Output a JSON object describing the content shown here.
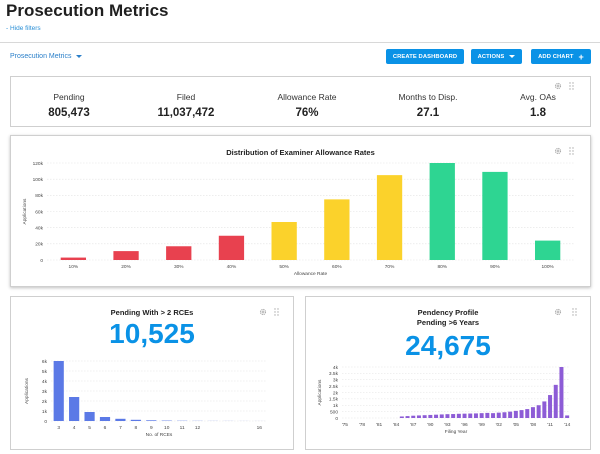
{
  "page": {
    "title": "Prosecution Metrics",
    "hide_filters": "- Hide filters",
    "dashboard_select": "Prosecution Metrics"
  },
  "toolbar": {
    "create_dashboard": "CREATE DASHBOARD",
    "actions": "ACTIONS",
    "add_chart": "ADD CHART"
  },
  "icons": {
    "settings": "gear-icon",
    "drag": "drag-handle-icon",
    "dropdown": "caret-down-icon",
    "add": "plus-icon"
  },
  "colors": {
    "accent": "#0a92e6",
    "red": "#e8414f",
    "yellow": "#fbd22b",
    "green": "#2ed592",
    "blue_bar": "#5b79e6",
    "purple_bar": "#8d5cd6"
  },
  "kpis": [
    {
      "label": "Pending",
      "value": "805,473"
    },
    {
      "label": "Filed",
      "value": "11,037,472"
    },
    {
      "label": "Allowance Rate",
      "value": "76%"
    },
    {
      "label": "Months to Disp.",
      "value": "27.1"
    },
    {
      "label": "Avg. OAs",
      "value": "1.8"
    }
  ],
  "chart_data": [
    {
      "type": "bar",
      "title": "Distribution of Examiner Allowance Rates",
      "xlabel": "Allowance Rate",
      "ylabel": "Applications",
      "categories": [
        "10%",
        "20%",
        "30%",
        "40%",
        "50%",
        "60%",
        "70%",
        "80%",
        "90%",
        "100%"
      ],
      "values": [
        3000,
        11000,
        17000,
        30000,
        47000,
        75000,
        105000,
        125000,
        109000,
        24000
      ],
      "bar_colors": [
        "red",
        "red",
        "red",
        "red",
        "yellow",
        "yellow",
        "yellow",
        "green",
        "green",
        "green"
      ],
      "ylim": [
        0,
        120000
      ],
      "yticks": [
        0,
        20000,
        40000,
        60000,
        80000,
        100000,
        120000
      ],
      "ytick_labels": [
        "0",
        "20k",
        "40k",
        "60k",
        "80k",
        "100k",
        "120k"
      ],
      "grid": true
    },
    {
      "type": "bar",
      "title": "Pending With > 2 RCEs",
      "headline": "10,525",
      "xlabel": "No. of RCEs",
      "ylabel": "Applications",
      "categories": [
        "3",
        "4",
        "5",
        "6",
        "7",
        "8",
        "9",
        "10",
        "11",
        "12",
        "13",
        "14",
        "15",
        "16"
      ],
      "xtick_labels": [
        "3",
        "4",
        "5",
        "6",
        "7",
        "8",
        "9",
        "10",
        "11",
        "12",
        "",
        "",
        "",
        "16"
      ],
      "values": [
        6600,
        2400,
        900,
        400,
        220,
        120,
        70,
        40,
        25,
        15,
        10,
        8,
        5,
        4
      ],
      "ylim": [
        0,
        6000
      ],
      "yticks": [
        0,
        1000,
        2000,
        3000,
        4000,
        5000,
        6000
      ],
      "ytick_labels": [
        "0",
        "1k",
        "2k",
        "3k",
        "4k",
        "5k",
        "6k"
      ],
      "grid": true
    },
    {
      "type": "bar",
      "title": "Pendency Profile",
      "subtitle": "Pending >6 Years",
      "headline": "24,675",
      "xlabel": "Filing Year",
      "ylabel": "Applications",
      "x": [
        1975,
        1976,
        1977,
        1978,
        1979,
        1980,
        1981,
        1982,
        1983,
        1984,
        1985,
        1986,
        1987,
        1988,
        1989,
        1990,
        1991,
        1992,
        1993,
        1994,
        1995,
        1996,
        1997,
        1998,
        1999,
        2000,
        2001,
        2002,
        2003,
        2004,
        2005,
        2006,
        2007,
        2008,
        2009,
        2010,
        2011,
        2012,
        2013,
        2014
      ],
      "values": [
        0,
        0,
        0,
        0,
        0,
        0,
        0,
        0,
        0,
        0,
        120,
        150,
        180,
        200,
        220,
        240,
        260,
        280,
        300,
        310,
        330,
        340,
        350,
        360,
        380,
        400,
        380,
        420,
        450,
        500,
        560,
        620,
        700,
        850,
        1000,
        1300,
        1800,
        2600,
        4100,
        200
      ],
      "xtick_labels": [
        "'75",
        "'78",
        "'81",
        "'84",
        "'87",
        "'90",
        "'93",
        "'96",
        "'99",
        "'02",
        "'05",
        "'08",
        "'11",
        "'14"
      ],
      "ylim": [
        0,
        4000
      ],
      "yticks": [
        0,
        500,
        1000,
        1500,
        2000,
        2500,
        3000,
        3500,
        4000
      ],
      "ytick_labels": [
        "0",
        "500",
        "1k",
        "1.5k",
        "2k",
        "2.5k",
        "3k",
        "3.5k",
        "4k"
      ],
      "grid": true
    }
  ]
}
